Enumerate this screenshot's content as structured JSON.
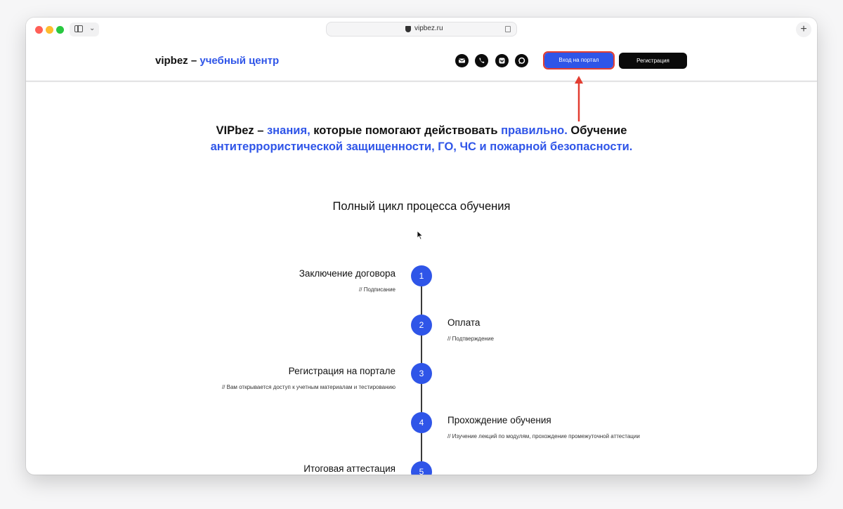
{
  "browser": {
    "url": "vipbez.ru",
    "new_tab": "+"
  },
  "header": {
    "logo_main": "vipbez –",
    "logo_accent": "учебный центр",
    "social_icons": [
      "mail-icon",
      "phone-icon",
      "vk-icon",
      "chat-icon"
    ],
    "login_button": "Вход на портал",
    "register_button": "Регистрация"
  },
  "hero": {
    "part1": "VIPbez – ",
    "part2": "знания,",
    "part3": " которые помогают действовать ",
    "part4": "правильно.",
    "part5": " Обучение",
    "part6": "антитеррористической защищенности, ГО, ЧС и пожарной безопасности."
  },
  "section": {
    "title": "Полный цикл процесса обучения"
  },
  "steps": [
    {
      "number": "1",
      "title": "Заключение договора",
      "subtitle": "// Подписание"
    },
    {
      "number": "2",
      "title": "Оплата",
      "subtitle": "// Подтверждение"
    },
    {
      "number": "3",
      "title": "Регистрация на портале",
      "subtitle": "// Вам открывается доступ к учетным материалам и тестированию"
    },
    {
      "number": "4",
      "title": "Прохождение обучения",
      "subtitle": "// Изучение лекций по модулям, прохождение промежуточной аттестации"
    },
    {
      "number": "5",
      "title": "Итоговая аттестация",
      "subtitle": ""
    }
  ],
  "colors": {
    "accent": "#2f55e8",
    "annotation": "#e23d31",
    "dark": "#0a0a0a"
  }
}
